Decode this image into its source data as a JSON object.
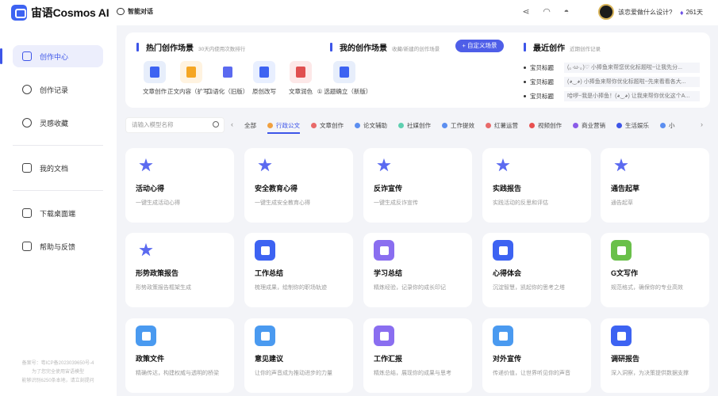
{
  "app": {
    "name": "宙语Cosmos AI"
  },
  "sidebar": {
    "items": [
      {
        "label": "创作中心",
        "icon": "home-icon",
        "active": true
      },
      {
        "label": "创作记录",
        "icon": "cloud-icon"
      },
      {
        "label": "灵感收藏",
        "icon": "bulb-icon"
      },
      {
        "label": "我的文档",
        "icon": "book-icon"
      },
      {
        "label": "下载桌面端",
        "icon": "monitor-icon"
      },
      {
        "label": "帮助与反馈",
        "icon": "help-icon"
      }
    ],
    "footer": [
      "备案号：粤ICP备2023039650号-4",
      "为了您完全使用宙语模型",
      "能够识别6250条本地，请立刻提问"
    ]
  },
  "topbar": {
    "chat_label": "智能对话",
    "question": "该恋爱做什么设计?",
    "vip_days": "261天",
    "icons": [
      "share-icon",
      "headset-icon",
      "bell-icon"
    ]
  },
  "hot": {
    "title": "热门创作场景",
    "subtitle": "30天内使用次数排行",
    "items": [
      {
        "label": "文章创作",
        "color": "#e7eefb",
        "ic": "#3d63f2"
      },
      {
        "label": "正文内容（扩写）",
        "color": "#fff3e0",
        "ic": "#f5a623"
      },
      {
        "label": "口语化（旧版）",
        "color": "#ffffff",
        "ic": "#5b6af0"
      },
      {
        "label": "原创改写",
        "color": "#e8efff",
        "ic": "#3d63f2"
      },
      {
        "label": "文章润色",
        "color": "#fde8e8",
        "ic": "#e04f4f"
      }
    ]
  },
  "mine": {
    "title": "我的创作场景",
    "subtitle": "收藏/新建的创作场景",
    "custom_button": "+ 自定义场景",
    "items": [
      {
        "label": "① 选题确立（新版）"
      }
    ]
  },
  "recent": {
    "title": "最近创作",
    "subtitle": "近期创作记录",
    "rows": [
      {
        "key": "宝贝标题",
        "value": "(｡·ω·｡)♡ 小捧鱼来帮您优化标题啦~让我先分..."
      },
      {
        "key": "宝贝标题",
        "value": "(◕‿◕) 小捧鱼来帮你优化标题啦~先来看看各大..."
      },
      {
        "key": "宝贝标题",
        "value": "哈啰~我是小捧鱼！(◕‿◕) 让我来帮你优化这个A..."
      }
    ]
  },
  "search": {
    "placeholder": "请输入模型名称"
  },
  "categories": [
    {
      "label": "全部",
      "color": ""
    },
    {
      "label": "行政公文",
      "color": "#f0a040",
      "active": true
    },
    {
      "label": "文章创作",
      "color": "#e86a6a"
    },
    {
      "label": "论文辅助",
      "color": "#5b8ef0"
    },
    {
      "label": "社媒创作",
      "color": "#5ecfb0"
    },
    {
      "label": "工作提效",
      "color": "#5b8ef0"
    },
    {
      "label": "红薯运营",
      "color": "#e86a6a"
    },
    {
      "label": "视频创作",
      "color": "#e85050"
    },
    {
      "label": "商业营销",
      "color": "#8a5be8"
    },
    {
      "label": "生活娱乐",
      "color": "#3d55e8"
    },
    {
      "label": "小",
      "color": "#5b8ef0"
    }
  ],
  "cards": [
    {
      "title": "活动心得",
      "desc": "一键生成活动心得",
      "kind": "star"
    },
    {
      "title": "安全教育心得",
      "desc": "一键生成安全教育心得",
      "kind": "star"
    },
    {
      "title": "反诈宣传",
      "desc": "一键生成反诈宣传",
      "kind": "star"
    },
    {
      "title": "实践报告",
      "desc": "实践活动的反思和评估",
      "kind": "star"
    },
    {
      "title": "通告起草",
      "desc": "通告起草",
      "kind": "star"
    },
    {
      "title": "形势政策报告",
      "desc": "形势政策报告框架生成",
      "kind": "star"
    },
    {
      "title": "工作总结",
      "desc": "梳理成果，绘制你的职场轨迹",
      "kind": "box",
      "color": "#3d63f2"
    },
    {
      "title": "学习总结",
      "desc": "精炼经验，记录你的成长印记",
      "kind": "box",
      "color": "#8a6ef0"
    },
    {
      "title": "心得体会",
      "desc": "沉淀智慧，凯起你的思考之塔",
      "kind": "box",
      "color": "#3d63f2"
    },
    {
      "title": "G文写作",
      "desc": "规范格式，确保你的专业高效",
      "kind": "box",
      "color": "#6ac04a"
    },
    {
      "title": "政策文件",
      "desc": "精确传达，构建权威与透明的桥梁",
      "kind": "box",
      "color": "#4a9af0"
    },
    {
      "title": "意见建议",
      "desc": "让你的声音成为推动进步的力量",
      "kind": "box",
      "color": "#4a9af0"
    },
    {
      "title": "工作汇报",
      "desc": "精炼总结，展现你的成果与思考",
      "kind": "box",
      "color": "#8a6ef0"
    },
    {
      "title": "对外宣传",
      "desc": "传递价值，让世界听见你的声音",
      "kind": "box",
      "color": "#4a9af0"
    },
    {
      "title": "调研报告",
      "desc": "深入洞察，为决策提供数据支撑",
      "kind": "box",
      "color": "#3d63f2"
    }
  ]
}
